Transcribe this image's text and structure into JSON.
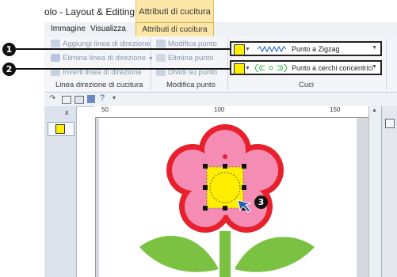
{
  "window": {
    "title": "olo - Layout & Editing",
    "context_tab": "Attributi di cucitura"
  },
  "ribbon_tabs": [
    "Immagine",
    "Visualizza",
    "Attributi di cucitura"
  ],
  "groups": {
    "direction": {
      "label": "Linea direzione di cucitura",
      "add": "Aggiungi linea di direzione",
      "delete": "Elimina linea di direzione",
      "invert": "Inverti linea di direzione"
    },
    "point": {
      "label": "Modifica punto",
      "edit": "Modifica punto",
      "delete": "Elimina punto",
      "split": "Dividi su punto"
    },
    "stitch": {
      "label": "Cuci",
      "line_stitch": "Punto a Zigzag",
      "region_stitch": "Punto a cerchi concentrici",
      "swatch_color": "#ffee00"
    }
  },
  "callouts": [
    "1",
    "2",
    "3"
  ],
  "rulers": {
    "top_ticks": [
      "50",
      "100",
      "150"
    ]
  },
  "left_panel": {
    "close_label": "x"
  },
  "colors": {
    "accent_tab": "#fde7a8",
    "petal_outline": "#e8202c",
    "petal_fill": "#f48cb4",
    "center_fill": "#ffee00",
    "leaf": "#7cc242"
  }
}
